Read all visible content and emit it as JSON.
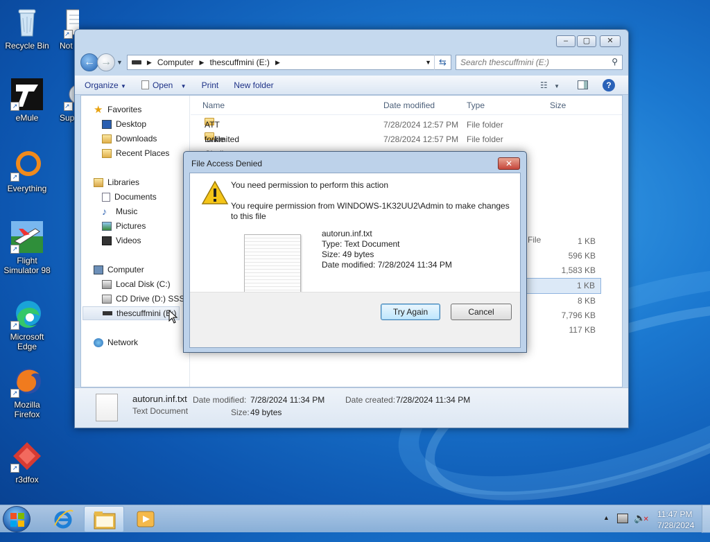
{
  "desktop": {
    "icons": [
      {
        "label": "Recycle Bin"
      },
      {
        "label": "Not"
      },
      {
        "label": "eMule"
      },
      {
        "label": "Sup"
      },
      {
        "label": "Everything"
      },
      {
        "label": "Flight Simulator 98"
      },
      {
        "label": "Microsoft Edge"
      },
      {
        "label": "Mozilla Firefox"
      },
      {
        "label": "r3dfox"
      }
    ]
  },
  "explorer": {
    "breadcrumb": [
      "Computer",
      "thescuffmini (E:)"
    ],
    "search_placeholder": "Search thescuffmini (E:)",
    "toolbar": {
      "organize": "Organize",
      "open": "Open",
      "print": "Print",
      "new_folder": "New folder"
    },
    "nav": {
      "favorites": "Favorites",
      "desktop": "Desktop",
      "downloads": "Downloads",
      "recent": "Recent Places",
      "libraries": "Libraries",
      "documents": "Documents",
      "music": "Music",
      "pictures": "Pictures",
      "videos": "Videos",
      "computer": "Computer",
      "local_disk": "Local Disk (C:)",
      "cd_drive": "CD Drive (D:) SSS_X",
      "thescuffmini": "thescuffmini (E:)",
      "network": "Network"
    },
    "columns": {
      "name": "Name",
      "date": "Date modified",
      "type": "Type",
      "size": "Size"
    },
    "files": [
      {
        "name": "ATT Unlimited Challenge 2",
        "date": "7/28/2024 12:57 PM",
        "type": "File folder",
        "size": ""
      },
      {
        "name": "forkle",
        "date": "7/28/2024 12:57 PM",
        "type": "File folder",
        "size": ""
      }
    ],
    "partial_type": "File",
    "sizes": [
      "1 KB",
      "596 KB",
      "1,583 KB",
      "1 KB",
      "8 KB",
      "7,796 KB",
      "117 KB"
    ],
    "details": {
      "filename": "autorun.inf.txt",
      "filetype": "Text Document",
      "date_modified_label": "Date modified:",
      "date_modified": "7/28/2024 11:34 PM",
      "date_created_label": "Date created:",
      "date_created": "7/28/2024 11:34 PM",
      "size_label": "Size:",
      "size": "49 bytes"
    }
  },
  "dialog": {
    "title": "File Access Denied",
    "heading": "You need permission to perform this action",
    "message": "You require permission from WINDOWS-1K32UU2\\Admin to make changes to this file",
    "file": {
      "name": "autorun.inf.txt",
      "type": "Type: Text Document",
      "size": "Size: 49 bytes",
      "modified": "Date modified: 7/28/2024 11:34 PM"
    },
    "try_again": "Try Again",
    "cancel": "Cancel"
  },
  "taskbar": {
    "time": "11:47 PM",
    "date": "7/28/2024"
  },
  "icons": {
    "favorites": "star-icon",
    "warning": "warning-icon"
  }
}
